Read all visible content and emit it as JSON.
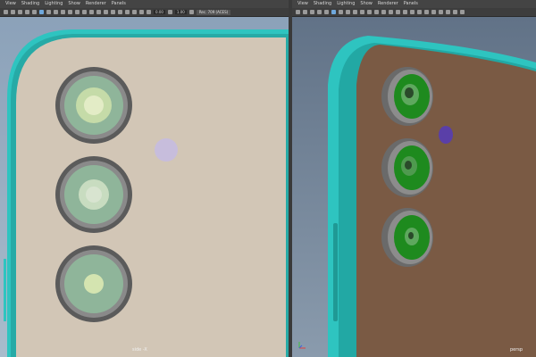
{
  "left_viewport": {
    "menu": [
      "View",
      "Shading",
      "Lighting",
      "Show",
      "Renderer",
      "Panels"
    ],
    "toolbar": {
      "field_1": "0.00",
      "field_2": "1.00",
      "color_space": "Rec. 709 (ACES)"
    },
    "camera_label": "side -X",
    "phone_back_color": "#d2c6b6",
    "frame_color": "#2ec4c0",
    "lens_color": "#8fb59a"
  },
  "right_viewport": {
    "menu": [
      "View",
      "Shading",
      "Lighting",
      "Show",
      "Renderer",
      "Panels"
    ],
    "camera_label": "persp",
    "phone_back_color": "#7a5a44",
    "frame_color": "#2ec4c0",
    "lens_color": "#1e8a1e"
  }
}
